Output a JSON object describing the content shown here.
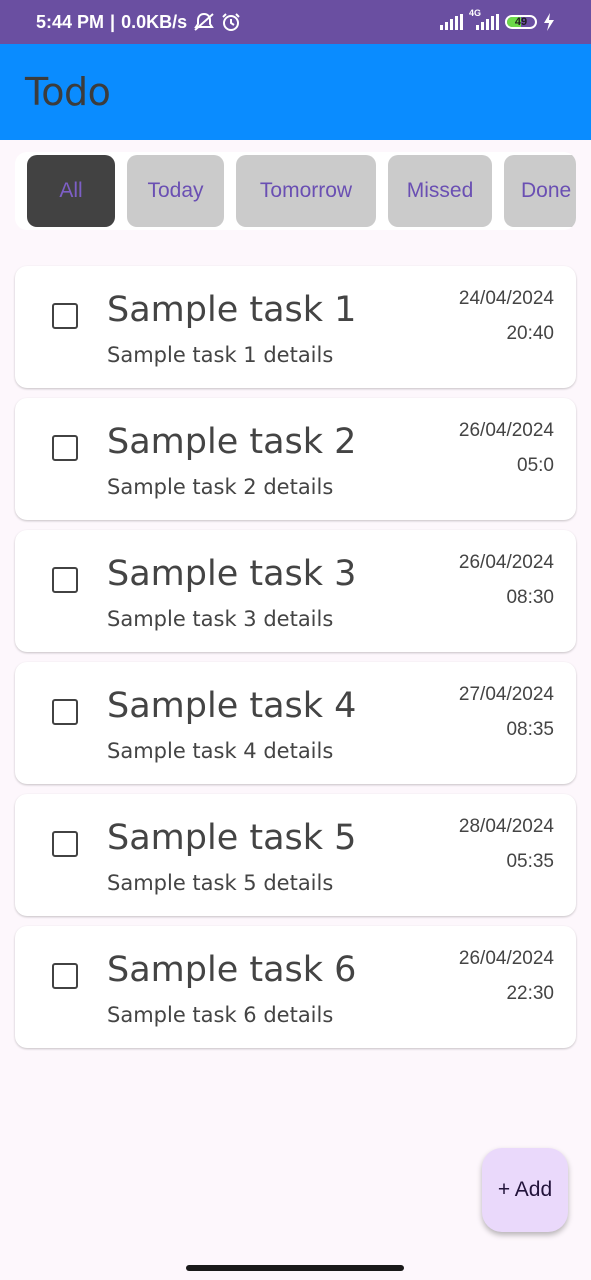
{
  "status_bar": {
    "time": "5:44 PM",
    "separator": "|",
    "speed": "0.0KB/s",
    "network_label": "4G",
    "battery_level": "49",
    "battery_fraction": 0.49,
    "icons": [
      "mute-notification-icon",
      "alarm-icon",
      "signal-icon",
      "signal-4g-icon",
      "battery-icon",
      "charging-icon"
    ],
    "background": "#6a4fa1"
  },
  "app_bar": {
    "title": "Todo",
    "background": "#0a8cff"
  },
  "filters": {
    "chips": [
      {
        "label": "All",
        "selected": true
      },
      {
        "label": "Today",
        "selected": false
      },
      {
        "label": "Tomorrow",
        "selected": false
      },
      {
        "label": "Missed",
        "selected": false
      },
      {
        "label": "Done",
        "selected": false
      }
    ],
    "selected_color": "#424242",
    "chip_color": "#cbcbcb",
    "text_color": "#6a4fb3"
  },
  "tasks": [
    {
      "title": "Sample task 1",
      "details": "Sample task 1 details",
      "date": "24/04/2024",
      "time": "20:40",
      "done": false
    },
    {
      "title": "Sample task 2",
      "details": "Sample task 2 details",
      "date": "26/04/2024",
      "time": "05:0",
      "done": false
    },
    {
      "title": "Sample task 3",
      "details": "Sample task 3 details",
      "date": "26/04/2024",
      "time": "08:30",
      "done": false
    },
    {
      "title": "Sample task 4",
      "details": "Sample task 4 details",
      "date": "27/04/2024",
      "time": "08:35",
      "done": false
    },
    {
      "title": "Sample task 5",
      "details": "Sample task 5 details",
      "date": "28/04/2024",
      "time": "05:35",
      "done": false
    },
    {
      "title": "Sample task 6",
      "details": "Sample task 6 details",
      "date": "26/04/2024",
      "time": "22:30",
      "done": false
    }
  ],
  "fab": {
    "label": "+ Add",
    "background": "#ead9fb"
  }
}
